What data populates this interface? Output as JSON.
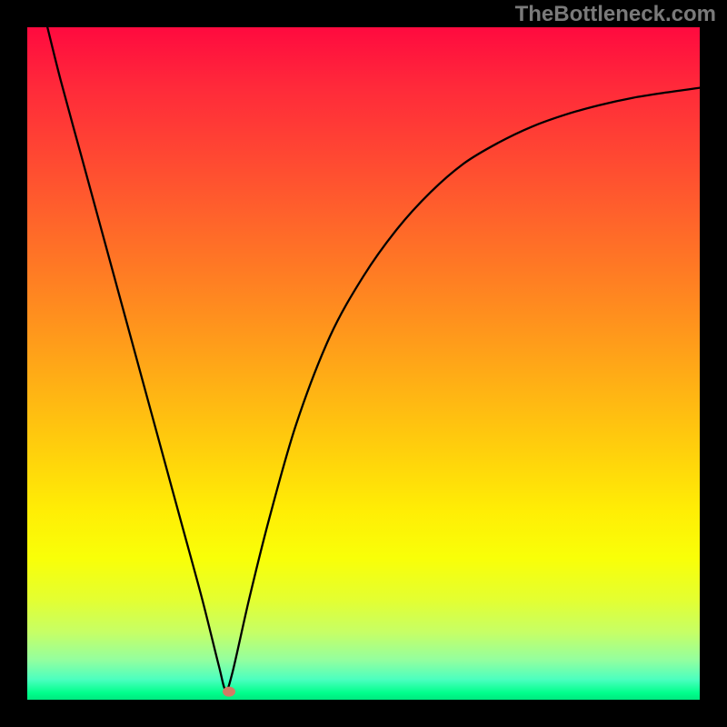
{
  "watermark": "TheBottleneck.com",
  "chart_data": {
    "type": "line",
    "title": "",
    "xlabel": "",
    "ylabel": "",
    "xlim": [
      0,
      100
    ],
    "ylim": [
      0,
      100
    ],
    "grid": false,
    "series": [
      {
        "name": "bottleneck-curve",
        "x": [
          3,
          5,
          8,
          11,
          14,
          17,
          20,
          23,
          26,
          28.5,
          29.5,
          30.5,
          33,
          36,
          40,
          45,
          50,
          55,
          60,
          65,
          70,
          75,
          80,
          85,
          90,
          95,
          100
        ],
        "y": [
          100,
          92,
          81,
          70,
          59,
          48,
          37,
          26,
          15,
          5,
          1.5,
          4,
          15,
          27,
          41,
          54,
          63,
          70,
          75.5,
          79.8,
          82.8,
          85.2,
          87,
          88.4,
          89.5,
          90.3,
          91
        ]
      }
    ],
    "marker": {
      "name": "optimal-point",
      "x": 30,
      "y": 1.2
    },
    "background": {
      "type": "vertical-gradient",
      "stops": [
        {
          "pos": 0,
          "color": "#ff0a3f"
        },
        {
          "pos": 50,
          "color": "#ffb314"
        },
        {
          "pos": 80,
          "color": "#f9ff08"
        },
        {
          "pos": 100,
          "color": "#00e87f"
        }
      ]
    }
  }
}
